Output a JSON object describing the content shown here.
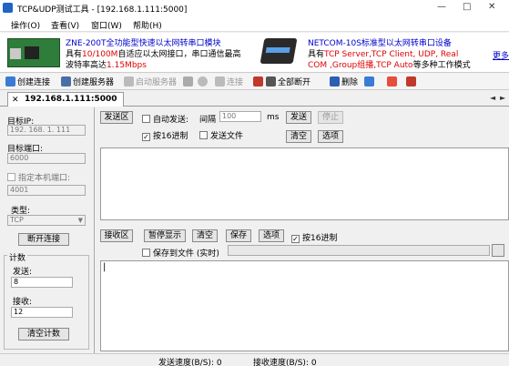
{
  "window": {
    "title": "TCP&UDP测试工具 - [192.168.1.111:5000]",
    "controls": [
      "—",
      "□",
      "✕"
    ]
  },
  "menu": [
    "操作(O)",
    "查看(V)",
    "窗口(W)",
    "帮助(H)"
  ],
  "banner": {
    "left": {
      "line1": "ZNE-200T全功能型快速以太网转串口模块",
      "line2_prefix": "具有",
      "line2_red": "10/100M",
      "line2_suffix": "自适应以太网接口，串口通信最高",
      "line3_prefix": "波特率高达",
      "line3_red": "1.15Mbps"
    },
    "right": {
      "line1": "NETCOM-10S标准型以太网转串口设备",
      "line2_prefix": "具有",
      "line2_red": "TCP Server,TCP Client, UDP, Real",
      "line3_red1": "COM ,Group组播,TCP Auto",
      "line3_suffix": "等多种工作模式"
    },
    "more": "更多"
  },
  "toolbar": {
    "create_conn": "创建连接",
    "create_server": "创建服务器",
    "start_server": "启动服务器",
    "connect": "连接",
    "disconnect_all": "全部断开",
    "delete": "删除"
  },
  "tab": {
    "label": "192.168.1.111:5000",
    "close": "✕"
  },
  "left": {
    "target_ip_label": "目标IP:",
    "target_ip_value": "192. 168. 1. 111",
    "target_port_label": "目标端口:",
    "target_port_value": "6000",
    "local_port_label": "指定本机端口:",
    "local_port_value": "4001",
    "type_label": "类型:",
    "type_value": "TCP",
    "disconnect_btn": "断开连接",
    "count_title": "计数",
    "send_label": "发送:",
    "send_value": "8",
    "recv_label": "接收:",
    "recv_value": "12",
    "clear_count_btn": "清空计数"
  },
  "send": {
    "area_btn": "发送区",
    "auto_send": "自动发送:",
    "interval_label": "间隔",
    "interval_value": "100",
    "interval_unit": "ms",
    "send_btn": "发送",
    "stop_btn": "停止",
    "hex_label": "按16进制",
    "hex_checked": "✓",
    "send_file": "发送文件",
    "clear_btn": "清空",
    "options_btn": "选项"
  },
  "recv": {
    "area_btn": "接收区",
    "pause_btn": "暂停显示",
    "clear_btn": "清空",
    "save_btn": "保存",
    "options_btn": "选项",
    "hex_label": "按16进制",
    "hex_checked": "✓",
    "save_file": "保存到文件 (实时)",
    "cursor": "|"
  },
  "status": {
    "send_speed": "发送速度(B/S): 0",
    "recv_speed": "接收速度(B/S): 0"
  },
  "colors": {
    "blue_link": "#0000cc",
    "red_text": "#e00000"
  }
}
